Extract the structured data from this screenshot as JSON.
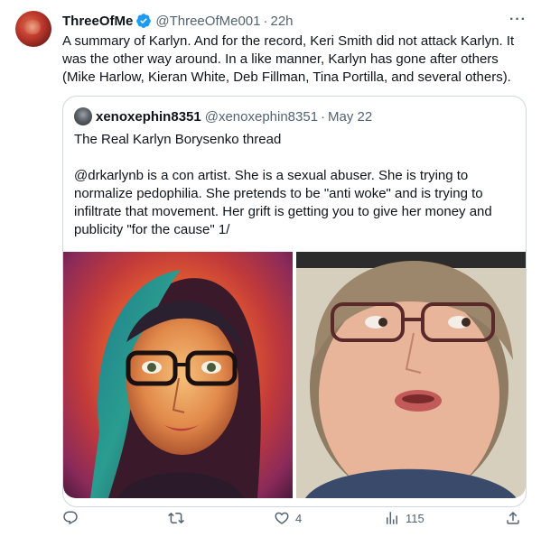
{
  "tweet": {
    "display_name": "ThreeOfMe",
    "handle": "@ThreeOfMe001",
    "separator": "·",
    "time": "22h",
    "more": "···",
    "text": "A summary of Karlyn. And for the record, Keri Smith did not attack Karlyn. It was the other way around. In a like manner, Karlyn has gone after others (Mike Harlow, Kieran White, Deb Fillman, Tina Portilla, and several others)."
  },
  "quote": {
    "display_name": "xenoxephin8351",
    "handle": "@xenoxephin8351",
    "separator": "·",
    "time": "May 22",
    "title": "The Real Karlyn Borysenko thread",
    "body": "@drkarlynb is a con artist. She is a sexual abuser. She is trying to normalize pedophilia. She pretends to be \"anti woke\" and is trying to infiltrate that movement. Her grift is getting you to give her money and publicity \"for the cause\" 1/"
  },
  "actions": {
    "reply": {
      "icon": "reply-icon",
      "count": ""
    },
    "retweet": {
      "icon": "retweet-icon",
      "count": ""
    },
    "like": {
      "icon": "heart-icon",
      "count": "4"
    },
    "views": {
      "icon": "views-icon",
      "count": "115"
    },
    "share": {
      "icon": "share-icon",
      "count": ""
    }
  },
  "colors": {
    "verified": "#1d9bf0",
    "muted": "#536471",
    "border": "#cfd9de",
    "text": "#0f1419"
  }
}
